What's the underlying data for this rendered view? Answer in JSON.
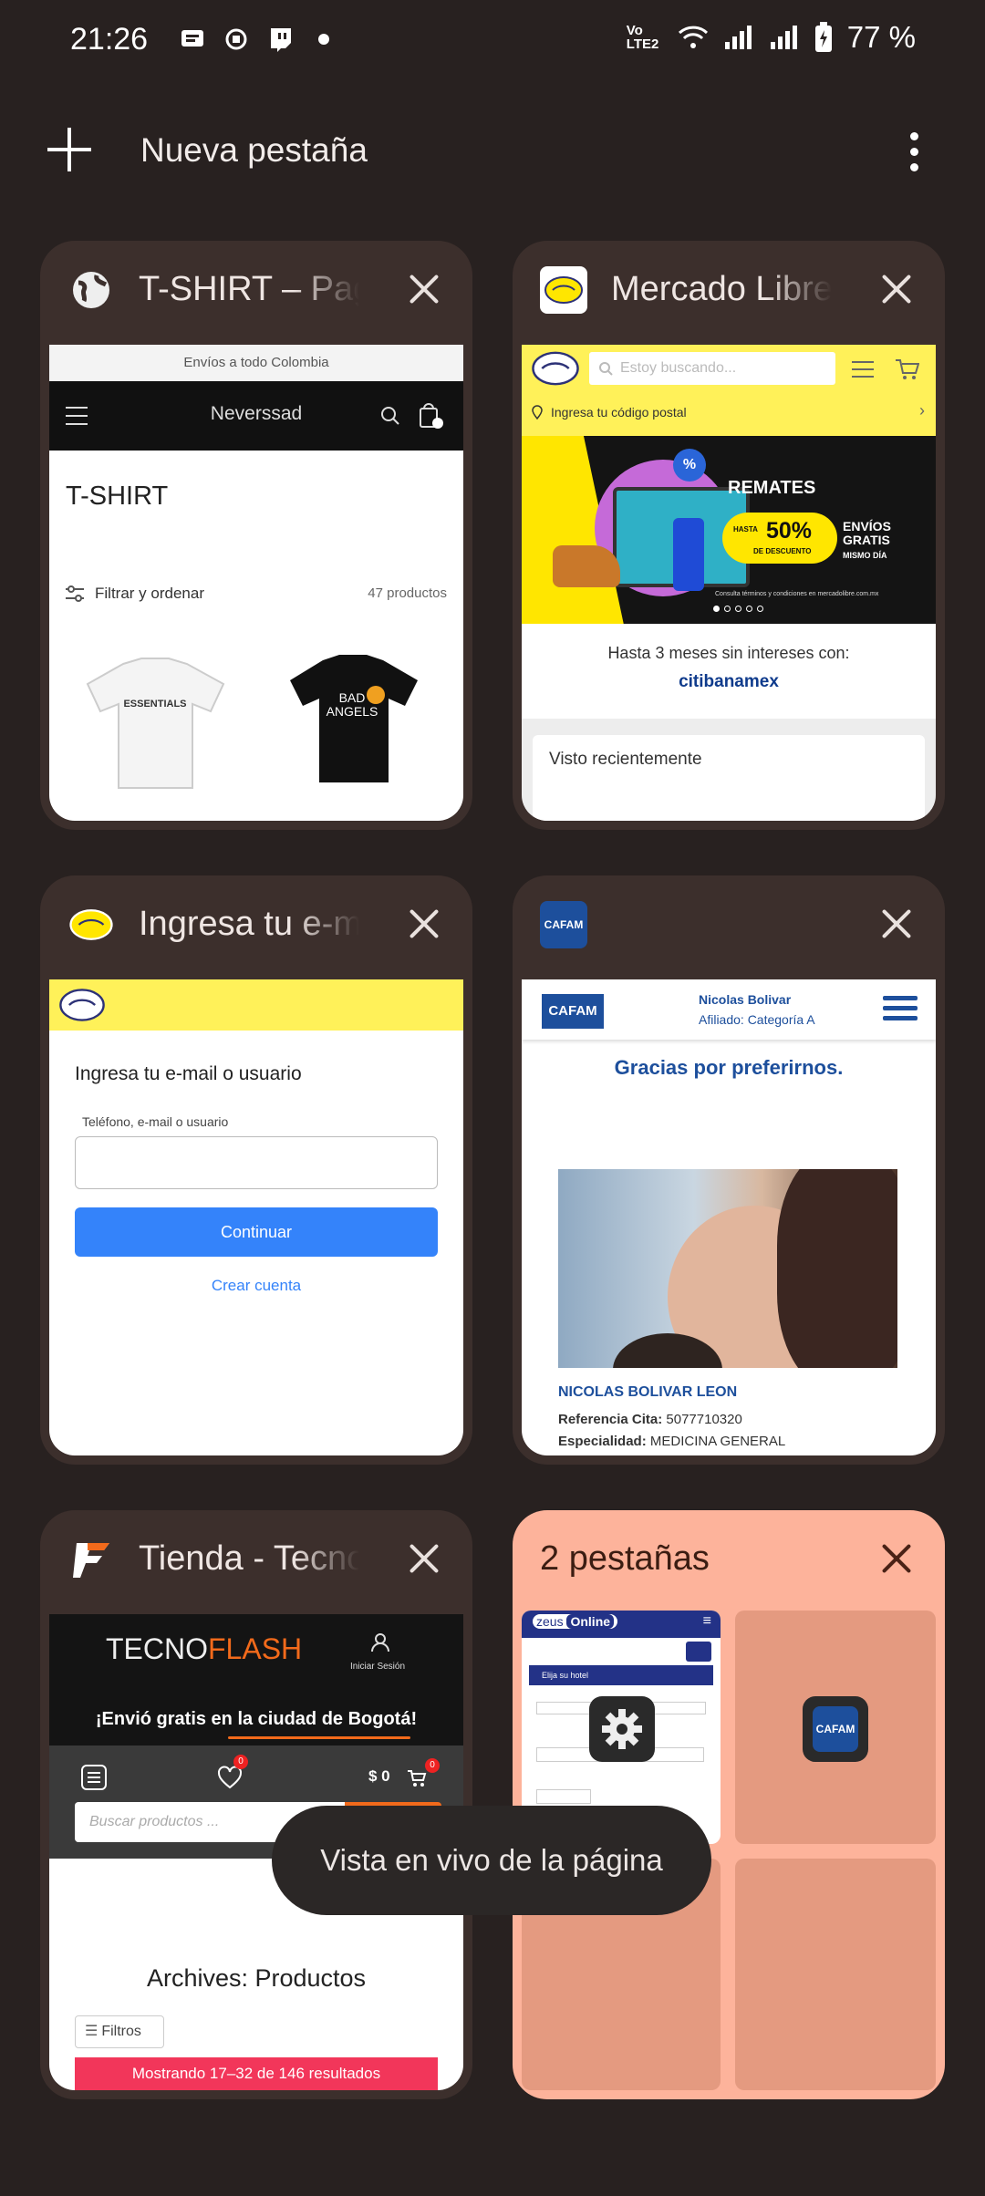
{
  "status": {
    "time": "21:26",
    "network": "Vo LTE2",
    "battery": "77 %"
  },
  "toolbar": {
    "new_tab": "Nueva pestaña"
  },
  "tabs": [
    {
      "title": "T-SHIRT – Page",
      "shot": {
        "banner": "Envíos a todo Colombia",
        "brand": "Neverssad",
        "heading": "T-SHIRT",
        "filter": "Filtrar y ordenar",
        "count": "47 productos",
        "shirt1": "ESSENTIALS",
        "shirt2": "BAD ANGELS"
      }
    },
    {
      "title": "Mercado Libre",
      "shot": {
        "search": "Estoy buscando...",
        "postal": "Ingresa tu código postal",
        "promo_title": "REMATES",
        "promo_pct": "50%",
        "promo_pct_pre": "HASTA",
        "promo_pct_sub": "DE DESCUENTO",
        "promo_ship": "ENVÍOS GRATIS",
        "promo_ship_sub": "MISMO DÍA",
        "promo_legal": "Consulta términos y condiciones en mercadolibre.com.mx",
        "msi": "Hasta 3 meses sin intereses con:",
        "bank": "citibanamex",
        "recent": "Visto recientemente"
      }
    },
    {
      "title": "Ingresa tu e-mail",
      "shot": {
        "heading": "Ingresa tu e-mail o usuario",
        "label": "Teléfono, e-mail o usuario",
        "continue": "Continuar",
        "create": "Crear cuenta"
      }
    },
    {
      "title": "",
      "shot": {
        "logo": "CAFAM",
        "user": "Nicolas Bolivar",
        "affiliate": "Afiliado: Categoría A",
        "thanks": "Gracias por preferirnos.",
        "name": "NICOLAS BOLIVAR LEON",
        "ref_label": "Referencia Cita:",
        "ref_value": "5077710320",
        "spec_label": "Especialidad:",
        "spec_value": "MEDICINA GENERAL"
      }
    },
    {
      "title": "Tienda - Tecnoflash",
      "shot": {
        "brand1": "TECNO",
        "brand2": "FLASH",
        "login": "Iniciar Sesión",
        "promo": "¡Envió gratis en la ciudad de Bogotá!",
        "cart": "$ 0",
        "badge": "0",
        "search": "Buscar productos ...",
        "archives": "Archives: Productos",
        "filters": "Filtros",
        "results": "Mostrando 17–32 de 146 resultados"
      }
    }
  ],
  "group": {
    "title": "2 pestañas",
    "zeus": "zeus",
    "online": "Online",
    "hotel_hint": "Elija su hotel",
    "cafam": "CAFAM"
  },
  "toast": "Vista en vivo de la página"
}
